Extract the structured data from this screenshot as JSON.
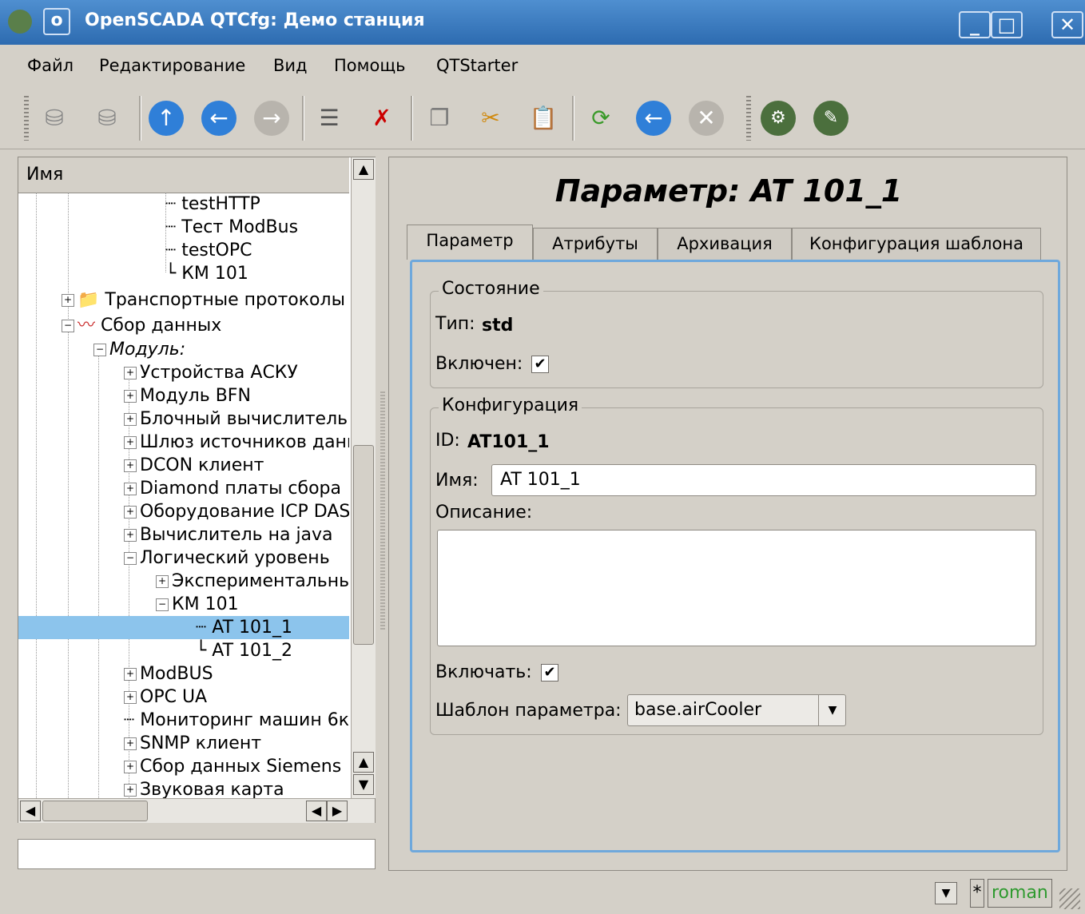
{
  "window": {
    "title": "OpenSCADA QTCfg: Демо станция",
    "buttons": {
      "minimize": "_",
      "maximize": "□",
      "close": "✕"
    }
  },
  "menu": [
    {
      "label": "Файл"
    },
    {
      "label": "Редактирование"
    },
    {
      "label": "Вид"
    },
    {
      "label": "Помощь"
    },
    {
      "label": "QTStarter"
    }
  ],
  "toolbar": {
    "icons": [
      "db-load-icon",
      "db-save-icon",
      "up-icon",
      "back-icon",
      "forward-icon",
      "add-item-icon",
      "delete-item-icon",
      "copy-icon",
      "cut-icon",
      "paste-icon",
      "refresh-icon",
      "start-icon",
      "stop-icon",
      "station-icon",
      "station-config-icon"
    ]
  },
  "tree": {
    "header": "Имя",
    "rows": [
      {
        "label": "testHTTP"
      },
      {
        "label": "Тест ModBus"
      },
      {
        "label": "testOPC"
      },
      {
        "label": "КМ 101"
      },
      {
        "label": "Транспортные протоколы"
      },
      {
        "label": "Сбор данных"
      },
      {
        "label": "Модуль:"
      },
      {
        "label": "Устройства АСКУ"
      },
      {
        "label": "Модуль BFN"
      },
      {
        "label": "Блочный вычислитель"
      },
      {
        "label": "Шлюз источников данных"
      },
      {
        "label": "DCON клиент"
      },
      {
        "label": "Diamond платы сбора"
      },
      {
        "label": "Оборудование ICP DAS"
      },
      {
        "label": "Вычислитель на java"
      },
      {
        "label": "Логический уровень"
      },
      {
        "label": "Экспериментальный"
      },
      {
        "label": "КМ 101"
      },
      {
        "label": "AT 101_1"
      },
      {
        "label": "AT 101_2"
      },
      {
        "label": "ModBUS"
      },
      {
        "label": "OPC UA"
      },
      {
        "label": "Мониторинг машин 6к"
      },
      {
        "label": "SNMP клиент"
      },
      {
        "label": "Сбор данных Siemens"
      },
      {
        "label": "Звуковая карта"
      }
    ]
  },
  "page": {
    "title": "Параметр: AT 101_1",
    "tabs": [
      "Параметр",
      "Атрибуты",
      "Архивация",
      "Конфигурация шаблона"
    ],
    "state_group": "Состояние",
    "type_label": "Тип:",
    "type_value": "std",
    "enabled_label": "Включен:",
    "enabled_checked": true,
    "config_group": "Конфигурация",
    "id_label": "ID:",
    "id_value": "AT101_1",
    "name_label": "Имя:",
    "name_value": "AT 101_1",
    "description_label": "Описание:",
    "description_value": "",
    "enable_label": "Включать:",
    "enable_checked": true,
    "template_label": "Шаблон параметра:",
    "template_value": "base.airCooler"
  },
  "status": {
    "star": "*",
    "user": "roman"
  }
}
